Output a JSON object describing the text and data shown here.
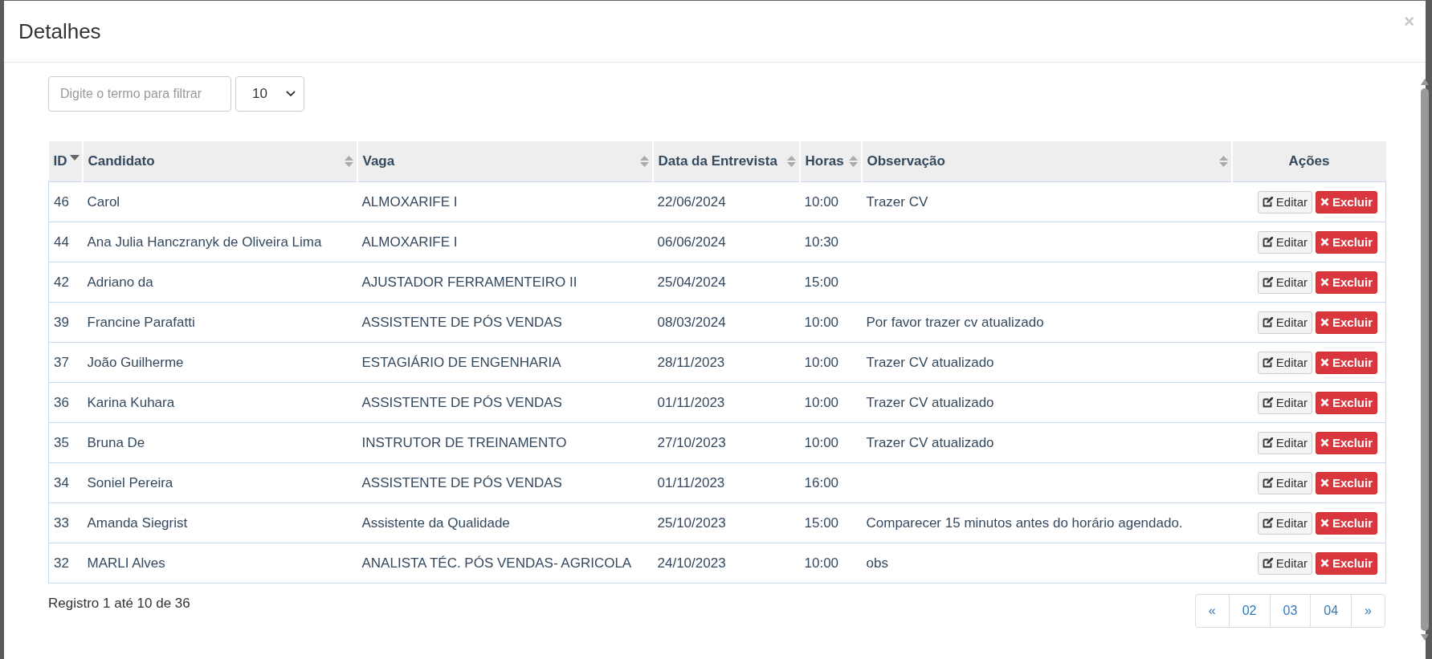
{
  "modal": {
    "title": "Detalhes",
    "close": "×"
  },
  "filter": {
    "placeholder": "Digite o termo para filtrar"
  },
  "page_size": {
    "value": "10"
  },
  "table": {
    "columns": [
      {
        "label": "ID",
        "sortable": true,
        "sorted_desc": true
      },
      {
        "label": "Candidato",
        "sortable": true,
        "sorted_desc": false
      },
      {
        "label": "Vaga",
        "sortable": true,
        "sorted_desc": false
      },
      {
        "label": "Data da Entrevista",
        "sortable": true,
        "sorted_desc": false
      },
      {
        "label": "Horas",
        "sortable": true,
        "sorted_desc": false
      },
      {
        "label": "Observação",
        "sortable": true,
        "sorted_desc": false
      },
      {
        "label": "Ações",
        "sortable": false,
        "sorted_desc": false
      }
    ],
    "rows": [
      {
        "id": "46",
        "candidato": "Carol",
        "vaga": "ALMOXARIFE I",
        "data": "22/06/2024",
        "horas": "10:00",
        "observacao": "Trazer CV",
        "edit": "Editar",
        "delete": "Excluir"
      },
      {
        "id": "44",
        "candidato": "Ana Julia Hanczranyk de Oliveira Lima",
        "vaga": "ALMOXARIFE I",
        "data": "06/06/2024",
        "horas": "10:30",
        "edit": "Editar",
        "delete": "Excluir"
      },
      {
        "id": "42",
        "candidato": "Adriano da",
        "vaga": "AJUSTADOR FERRAMENTEIRO II",
        "data": "25/04/2024",
        "horas": "15:00",
        "edit": "Editar",
        "delete": "Excluir"
      },
      {
        "id": "39",
        "candidato": "Francine Parafatti",
        "vaga": "ASSISTENTE DE PÓS VENDAS",
        "data": "08/03/2024",
        "horas": "10:00",
        "observacao": "Por favor trazer cv atualizado",
        "edit": "Editar",
        "delete": "Excluir"
      },
      {
        "id": "37",
        "candidato": "João Guilherme",
        "vaga": "ESTAGIÁRIO DE ENGENHARIA",
        "data": "28/11/2023",
        "horas": "10:00",
        "observacao": "Trazer CV atualizado",
        "edit": "Editar",
        "delete": "Excluir"
      },
      {
        "id": "36",
        "candidato": "Karina Kuhara",
        "vaga": "ASSISTENTE DE PÓS VENDAS",
        "data": "01/11/2023",
        "horas": "10:00",
        "observacao": "Trazer CV atualizado",
        "edit": "Editar",
        "delete": "Excluir"
      },
      {
        "id": "35",
        "candidato": "Bruna De",
        "vaga": "INSTRUTOR DE TREINAMENTO",
        "data": "27/10/2023",
        "horas": "10:00",
        "observacao": "Trazer CV atualizado",
        "edit": "Editar",
        "delete": "Excluir"
      },
      {
        "id": "34",
        "candidato": "Soniel Pereira",
        "vaga": "ASSISTENTE DE PÓS VENDAS",
        "data": "01/11/2023",
        "horas": "16:00",
        "edit": "Editar",
        "delete": "Excluir"
      },
      {
        "id": "33",
        "candidato": "Amanda Siegrist",
        "vaga": "Assistente da Qualidade",
        "data": "25/10/2023",
        "horas": "15:00",
        "observacao": "Comparecer 15 minutos antes do horário agendado.",
        "edit": "Editar",
        "delete": "Excluir"
      },
      {
        "id": "32",
        "candidato": "MARLI Alves",
        "vaga": "ANALISTA TÉC. PÓS VENDAS- AGRICOLA",
        "data": "24/10/2023",
        "horas": "10:00",
        "observacao": "obs",
        "edit": "Editar",
        "delete": "Excluir"
      }
    ]
  },
  "record_count": "Registro 1 até 10 de 36",
  "pagination": [
    {
      "label": "«"
    },
    {
      "label": "02"
    },
    {
      "label": "03"
    },
    {
      "label": "04"
    },
    {
      "label": "»"
    }
  ]
}
